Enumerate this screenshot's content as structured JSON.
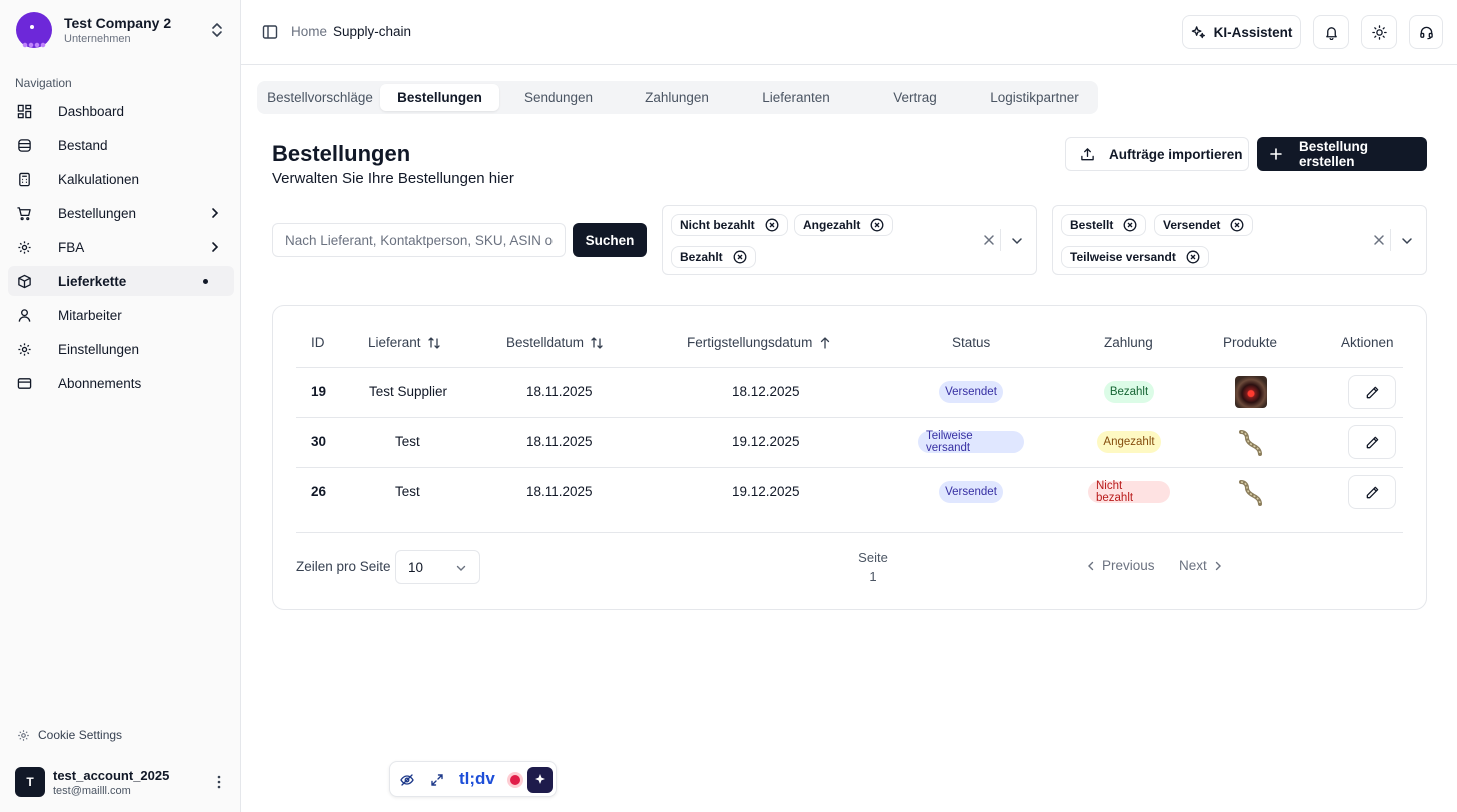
{
  "company": {
    "name": "Test Company 2",
    "subtitle": "Unternehmen"
  },
  "sidebar": {
    "section_label": "Navigation",
    "items": [
      {
        "label": "Dashboard",
        "icon": "dashboard-icon"
      },
      {
        "label": "Bestand",
        "icon": "database-icon"
      },
      {
        "label": "Kalkulationen",
        "icon": "calculator-icon"
      },
      {
        "label": "Bestellungen",
        "icon": "cart-icon",
        "has_submenu": true
      },
      {
        "label": "FBA",
        "icon": "gear-icon",
        "has_submenu": true
      },
      {
        "label": "Lieferkette",
        "icon": "box-icon",
        "active": true
      },
      {
        "label": "Mitarbeiter",
        "icon": "user-icon"
      },
      {
        "label": "Einstellungen",
        "icon": "settings-icon"
      },
      {
        "label": "Abonnements",
        "icon": "credit-card-icon"
      }
    ],
    "cookie_settings": "Cookie Settings",
    "user": {
      "initial": "T",
      "name": "test_account_2025",
      "email": "test@mailll.com"
    }
  },
  "header": {
    "breadcrumb": {
      "home": "Home",
      "current": "Supply-chain"
    },
    "ki_button": "KI-Assistent"
  },
  "tabs": [
    {
      "label": "Bestellvorschläge"
    },
    {
      "label": "Bestellungen",
      "active": true
    },
    {
      "label": "Sendungen"
    },
    {
      "label": "Zahlungen"
    },
    {
      "label": "Lieferanten"
    },
    {
      "label": "Vertrag"
    },
    {
      "label": "Logistikpartner"
    }
  ],
  "page": {
    "title": "Bestellungen",
    "subtitle": "Verwalten Sie Ihre Bestellungen hier",
    "import_button": "Aufträge importieren",
    "create_button": "Bestellung erstellen"
  },
  "filters": {
    "search_placeholder": "Nach Lieferant, Kontaktperson, SKU, ASIN oder",
    "search_button": "Suchen",
    "payment_chips": [
      "Nicht bezahlt",
      "Angezahlt",
      "Bezahlt"
    ],
    "status_chips": [
      "Bestellt",
      "Versendet",
      "Teilweise versandt"
    ]
  },
  "table": {
    "headers": {
      "id": "ID",
      "supplier": "Lieferant",
      "order_date": "Bestelldatum",
      "completion_date": "Fertigstellungsdatum",
      "status": "Status",
      "payment": "Zahlung",
      "products": "Produkte",
      "actions": "Aktionen"
    },
    "rows": [
      {
        "id": "19",
        "supplier": "Test Supplier",
        "order_date": "18.11.2025",
        "completion_date": "18.12.2025",
        "status": "Versendet",
        "payment": "Bezahlt",
        "product_image": "robot-image"
      },
      {
        "id": "30",
        "supplier": "Test",
        "order_date": "18.11.2025",
        "completion_date": "19.12.2025",
        "status": "Teilweise versandt",
        "payment": "Angezahlt",
        "product_image": "rope-image"
      },
      {
        "id": "26",
        "supplier": "Test",
        "order_date": "18.11.2025",
        "completion_date": "19.12.2025",
        "status": "Versendet",
        "payment": "Nicht bezahlt",
        "product_image": "rope-image"
      }
    ]
  },
  "pagination": {
    "rows_per_page_label": "Zeilen pro Seite",
    "rows_per_page_value": "10",
    "page_label": "Seite",
    "page_number": "1",
    "previous": "Previous",
    "next": "Next"
  },
  "tldv": {
    "brand": "tl;dv"
  }
}
